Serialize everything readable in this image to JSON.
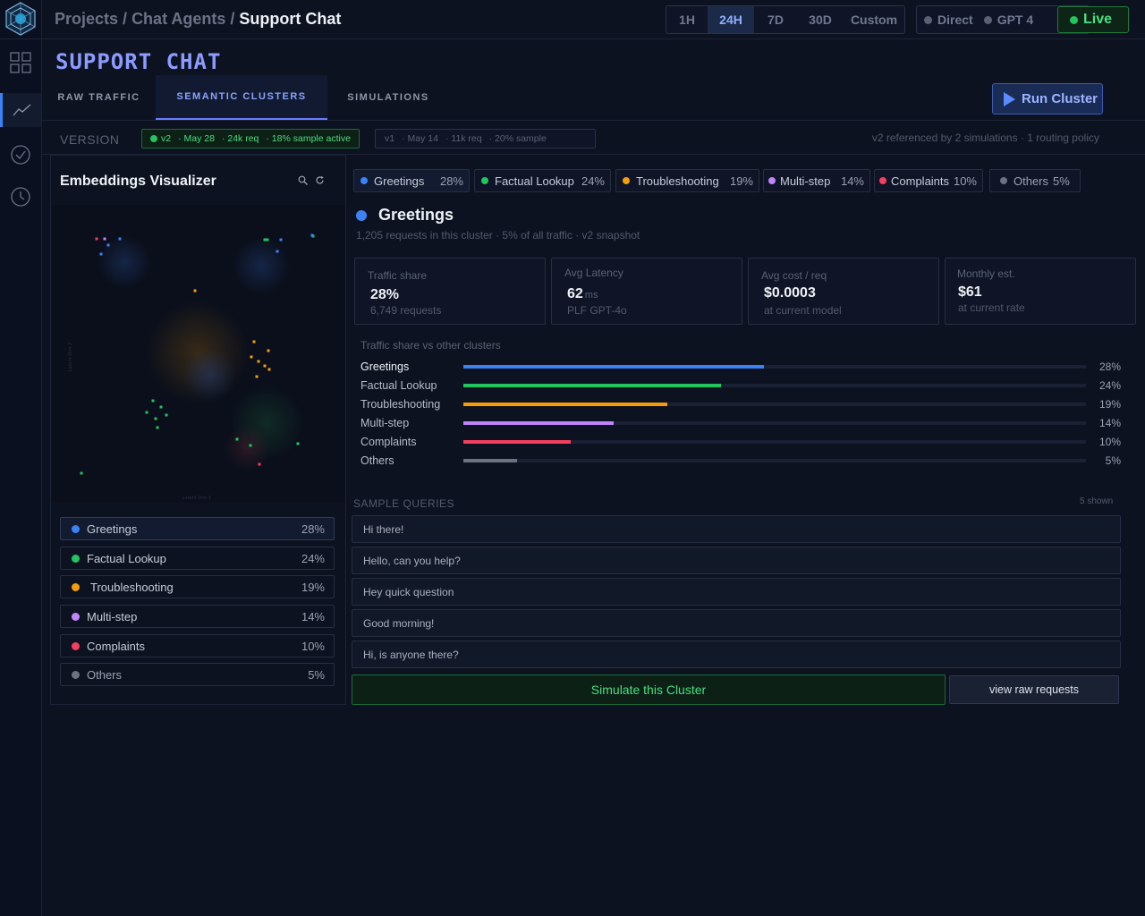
{
  "breadcrumb": {
    "part1": "Projects",
    "sep1": " / ",
    "part2": "Chat Agents",
    "sep2": " / ",
    "current": "Support Chat"
  },
  "time_range": {
    "options": [
      "1H",
      "24H",
      "7D",
      "30D",
      "Custom"
    ],
    "selected": "24H"
  },
  "routing": {
    "mode": "Direct",
    "model": "GPT 4"
  },
  "live_label": "Live",
  "page_title": "SUPPORT CHAT",
  "tabs": [
    {
      "label": "RAW TRAFFIC"
    },
    {
      "label": "SEMANTIC CLUSTERS"
    },
    {
      "label": "SIMULATIONS"
    }
  ],
  "run_button": "Run Cluster",
  "version": {
    "label": "VERSION",
    "active": {
      "name": "v2",
      "date": "· May 28",
      "req": "· 24k req",
      "sample": "· 18% sample active"
    },
    "previous": {
      "name": "v1",
      "date": "· May 14",
      "req": "· 11k req",
      "sample": "· 20% sample"
    },
    "info": "v2 referenced by 2 simulations · 1 routing policy"
  },
  "visualizer": {
    "title": "Embeddings Visualizer",
    "x_axis": "Latent Dim 1",
    "y_axis": "Latent Dim 2"
  },
  "clusters": [
    {
      "name": "Greetings",
      "pct": "28%",
      "chip_pct": "28%",
      "color": "#3b82f6",
      "share": 28
    },
    {
      "name": "Factual Lookup",
      "pct": "24%",
      "chip_pct": "24%",
      "color": "#22c55e",
      "share": 24
    },
    {
      "name": "Troubleshooting",
      "pct": "19%",
      "chip_pct": "19%",
      "color": "#f59e0b",
      "share": 19
    },
    {
      "name": "Multi-step",
      "pct": "14%",
      "chip_pct": "14%",
      "color": "#c084fc",
      "share": 14
    },
    {
      "name": "Complaints",
      "pct": "10%",
      "chip_pct": "10%",
      "color": "#f43f5e",
      "share": 10
    },
    {
      "name": "Others",
      "pct": "5%",
      "chip_pct": "5%",
      "color": "#6b7280",
      "share": 5
    }
  ],
  "selected_cluster": {
    "name": "Greetings",
    "subtitle": "1,205 requests in this cluster · 5% of all traffic · v2 snapshot"
  },
  "metrics": [
    {
      "label": "Traffic share",
      "value": "28%",
      "unit": "",
      "sub": "6,749 requests"
    },
    {
      "label": "Avg Latency",
      "value": "62",
      "unit": "ms",
      "sub": "PLF   GPT-4o"
    },
    {
      "label": "Avg cost / req",
      "value": "$0.0003",
      "unit": "",
      "sub": "at current model"
    },
    {
      "label": "Monthly est.",
      "value": "$61",
      "unit": "",
      "sub": "at current rate"
    }
  ],
  "share_chart": {
    "title": "Traffic share vs other clusters"
  },
  "sample_queries": {
    "title": "SAMPLE QUERIES",
    "count": "5 shown",
    "items": [
      "Hi there!",
      "Hello, can you help?",
      "Hey quick question",
      "Good morning!",
      "Hi, is anyone there?"
    ]
  },
  "simulate_button": "Simulate this Cluster",
  "raw_button": "view raw requests"
}
